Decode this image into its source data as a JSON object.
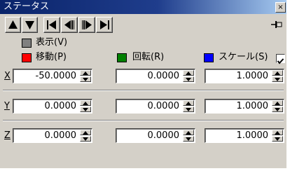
{
  "window": {
    "title": "ステータス",
    "close_label": "×"
  },
  "toolbar": {
    "nav_buttons": [
      "move-up",
      "move-down",
      "first-frame",
      "prev-key",
      "next-key",
      "last-frame"
    ],
    "pin_icon": "pin-icon"
  },
  "display": {
    "label": "表示(V)"
  },
  "channels": [
    {
      "label": "移動(P)",
      "color": "#ff0000"
    },
    {
      "label": "回転(R)",
      "color": "#008000"
    },
    {
      "label": "スケール(S)",
      "color": "#0000ff"
    }
  ],
  "colors": {
    "display_swatch": "#808080",
    "window_bg": "#d4d0c8",
    "title_bar": "#0a246a"
  },
  "axes": [
    {
      "label": "X",
      "values": [
        "-50.0000",
        "0.0000",
        "1.0000"
      ]
    },
    {
      "label": "Y",
      "values": [
        "0.0000",
        "0.0000",
        "1.0000"
      ]
    },
    {
      "label": "Z",
      "values": [
        "0.0000",
        "0.0000",
        "1.0000"
      ]
    }
  ]
}
